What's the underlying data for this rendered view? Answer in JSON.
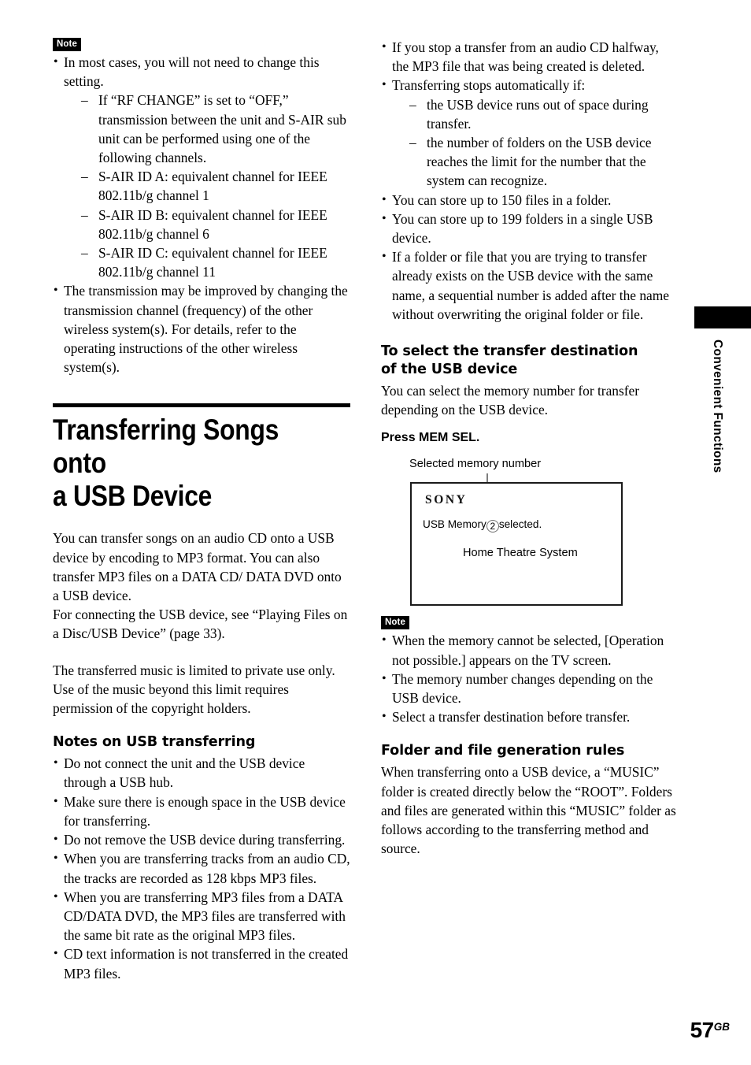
{
  "page": {
    "number": "57",
    "region_code": "GB",
    "side_tab_label": "Convenient Functions"
  },
  "left_column": {
    "note_badge": "Note",
    "note_bullets": [
      "In most cases, you will not need to change this setting.",
      "The transmission may be improved by changing the transmission channel (frequency) of the other wireless system(s). For details, refer to the operating instructions of the other wireless system(s)."
    ],
    "note_sub_items": [
      "If “RF CHANGE” is set to “OFF,” transmission between the unit and S-AIR sub unit can be performed using one of the following channels.",
      "S-AIR ID A: equivalent channel for IEEE 802.11b/g channel 1",
      "S-AIR ID B: equivalent channel for IEEE 802.11b/g channel 6",
      "S-AIR ID C: equivalent channel for IEEE 802.11b/g channel 11"
    ],
    "chapter_title": "Transferring Songs onto\na USB Device",
    "intro_paragraph_1": "You can transfer songs on an audio CD onto a USB device by encoding to MP3 format. You can also transfer MP3 files on a DATA CD/ DATA DVD onto a USB device.",
    "intro_paragraph_2": "For connecting the USB device, see “Playing Files on a Disc/USB Device” (page 33).",
    "intro_paragraph_3": "The transferred music is limited to private use only. Use of the music beyond this limit requires permission of the copyright holders.",
    "notes_heading": "Notes on USB transferring",
    "notes_bullets": [
      "Do not connect the unit and the USB device through a USB hub.",
      "Make sure there is enough space in the USB device for transferring.",
      "Do not remove the USB device during transferring.",
      "When you are transferring tracks from an audio CD, the tracks are recorded as 128 kbps MP3 files.",
      "When you are transferring MP3 files from a DATA CD/DATA DVD, the MP3 files are transferred with the same bit rate as the original MP3 files.",
      "CD text information is not transferred in the created MP3 files."
    ]
  },
  "right_column": {
    "top_bullets_1": [
      "If you stop a transfer from an audio CD halfway, the MP3 file that was being created is deleted.",
      "Transferring stops automatically if:"
    ],
    "stop_sub_items": [
      "the USB device runs out of space during transfer.",
      "the number of folders on the USB device reaches the limit for the number that the system can recognize."
    ],
    "top_bullets_2": [
      "You can store up to 150 files in a folder.",
      "You can store up to 199 folders in a single USB device.",
      "If a folder or file that you are trying to transfer already exists on the USB device with the same name, a sequential number is added after the name without overwriting the original folder or file."
    ],
    "select_heading": "To select the transfer destination\nof the USB device",
    "select_paragraph": "You can select the memory number for transfer depending on the USB device.",
    "press_instruction": "Press MEM SEL.",
    "figure": {
      "caption": "Selected memory number",
      "brand_logo": "SONY",
      "screen_line_prefix": "USB Memory",
      "screen_circled_number": "2",
      "screen_line_suffix": "selected.",
      "screen_subtitle": "Home Theatre System"
    },
    "note_badge": "Note",
    "note_bullets": [
      "When the memory cannot be selected, [Operation not possible.] appears on the TV screen.",
      "The memory number changes depending on the USB device.",
      "Select a transfer destination before transfer."
    ],
    "folder_heading": "Folder and file generation rules",
    "folder_paragraph": "When transferring onto a USB device, a “MUSIC” folder is created directly below the “ROOT”. Folders and files are generated within this “MUSIC” folder as follows according to the transferring method and source."
  }
}
